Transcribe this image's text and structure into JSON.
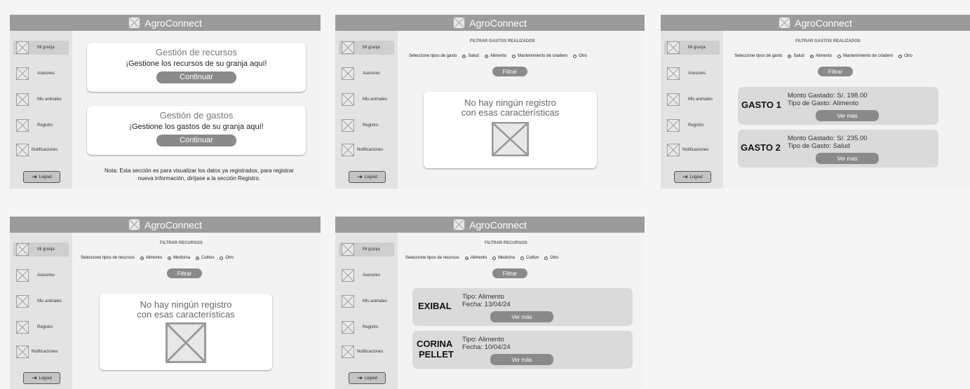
{
  "app": {
    "title": "AgroConnect"
  },
  "sidebar": {
    "items": [
      {
        "label": "Mi granja"
      },
      {
        "label": "Asesores"
      },
      {
        "label": "Mis animales"
      },
      {
        "label": "Registro"
      },
      {
        "label": "Notificaciones"
      }
    ],
    "logout": "Logout"
  },
  "screen1": {
    "card1": {
      "title": "Gestión de recursos",
      "subtitle": "¡Gestione los recursos de su granja aquí!",
      "button": "Continuar"
    },
    "card2": {
      "title": "Gestión de gastos",
      "subtitle": "¡Gestione los gastos de su granja aquí!",
      "button": "Continuar"
    },
    "note_line1": "Nota: Esta sección es para visualizar los datos ya registrados, para registrar",
    "note_line2": "nueva información, diríjase a la sección Registro."
  },
  "gastos_filter": {
    "title": "FILTRAR GASTOS REALIZADOS",
    "prompt": "Seleccione tipos de gasto",
    "options": [
      "Salud",
      "Alimento",
      "Mantenimiento de criadero",
      "Otro"
    ],
    "selected": [
      "Salud",
      "Alimento"
    ],
    "button": "Filtrar"
  },
  "recursos_filter": {
    "title": "FILTRAR RECURSOS",
    "prompt": "Seleccione tipos de recursos",
    "options_screen4": [
      "Alimento",
      "Medicina",
      "Cultivo",
      "Otro"
    ],
    "selected_screen4": [
      "Alimento",
      "Medicina",
      "Cultivo"
    ],
    "options_screen5": [
      "Alimento",
      "Medicina",
      "Cultivo",
      "Otro"
    ],
    "selected_screen5": [
      "Alimento"
    ],
    "button": "Filtrar"
  },
  "empty_state": {
    "line1": "No hay ningún registro",
    "line2": "con esas características"
  },
  "gastos_results": [
    {
      "name": "GASTO 1",
      "line1": "Monto Gastado: S/. 198.00",
      "line2": "Tipo de Gasto: Alimento",
      "button": "Ver más"
    },
    {
      "name": "GASTO 2",
      "line1": "Monto Gastado: S/. 235.00",
      "line2": "Tipo de Gasto: Salud",
      "button": "Ver más"
    }
  ],
  "recursos_results": [
    {
      "name_line1": "EXIBAL",
      "name_line2": "",
      "line1": "Tipo: Alimento",
      "line2": "Fecha: 13/04/24",
      "button": "Ver más"
    },
    {
      "name_line1": "CORINA",
      "name_line2": "PELLET",
      "line1": "Tipo: Alimento",
      "line2": "Fecha: 10/04/24",
      "button": "Ver más"
    }
  ],
  "icons": {
    "placeholder": "placeholder-image-icon",
    "logout": "logout-icon"
  },
  "colors": {
    "header": "#9b9b9b",
    "sidebar": "#e3e3e3",
    "button": "#8a8a8a",
    "result_card": "#dadada"
  }
}
